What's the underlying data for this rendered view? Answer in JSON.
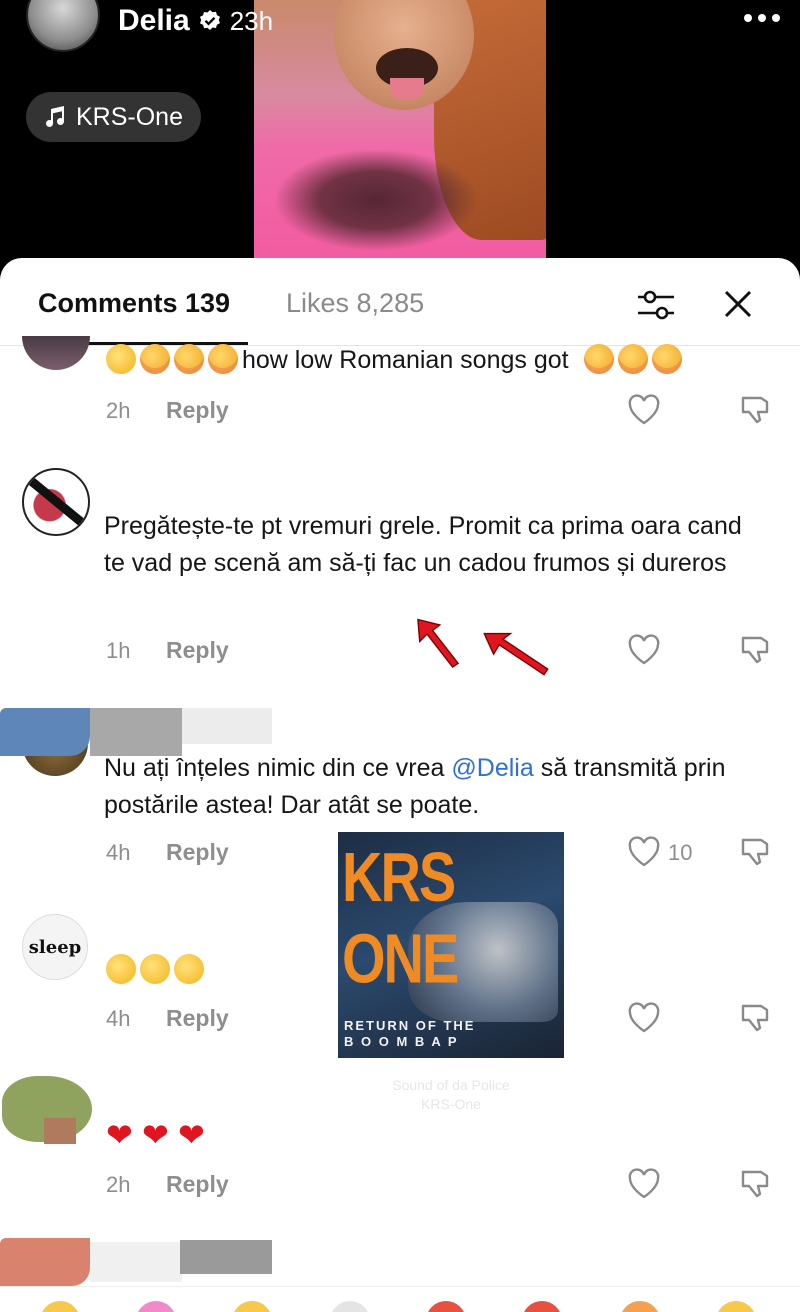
{
  "story": {
    "author": "Delia",
    "time": "23h",
    "music": "KRS-One"
  },
  "tabs": {
    "comments": "Comments 139",
    "likes": "Likes 8,285"
  },
  "comments": [
    {
      "text": "how low Romanian songs got",
      "time": "2h",
      "reply": "Reply"
    },
    {
      "text": "Pregătește-te pt vremuri grele. Promit ca prima oara cand te vad pe scenă am să-ți fac un cadou frumos și dureros",
      "time": "1h",
      "reply": "Reply"
    },
    {
      "text_before": "Nu ați înțeles nimic din ce vrea",
      "mention": "@Delia",
      "text_after": "să transmită prin postările astea! Dar atât se poate.",
      "time": "4h",
      "reply": "Reply",
      "likes": "10"
    },
    {
      "time": "4h",
      "reply": "Reply",
      "avatar_text": "sleep"
    },
    {
      "time": "2h",
      "reply": "Reply"
    }
  ],
  "album": {
    "title": "KRS ONE",
    "subtitle_line1": "RETURN OF THE",
    "subtitle_line2": "B O O M   B A P",
    "caption_title": "Sound of da Police",
    "caption_artist": "KRS-One"
  },
  "colors": {
    "mention": "#2f6fd6",
    "arrow": "#e0151f",
    "story_pink": "#f25aa0"
  }
}
